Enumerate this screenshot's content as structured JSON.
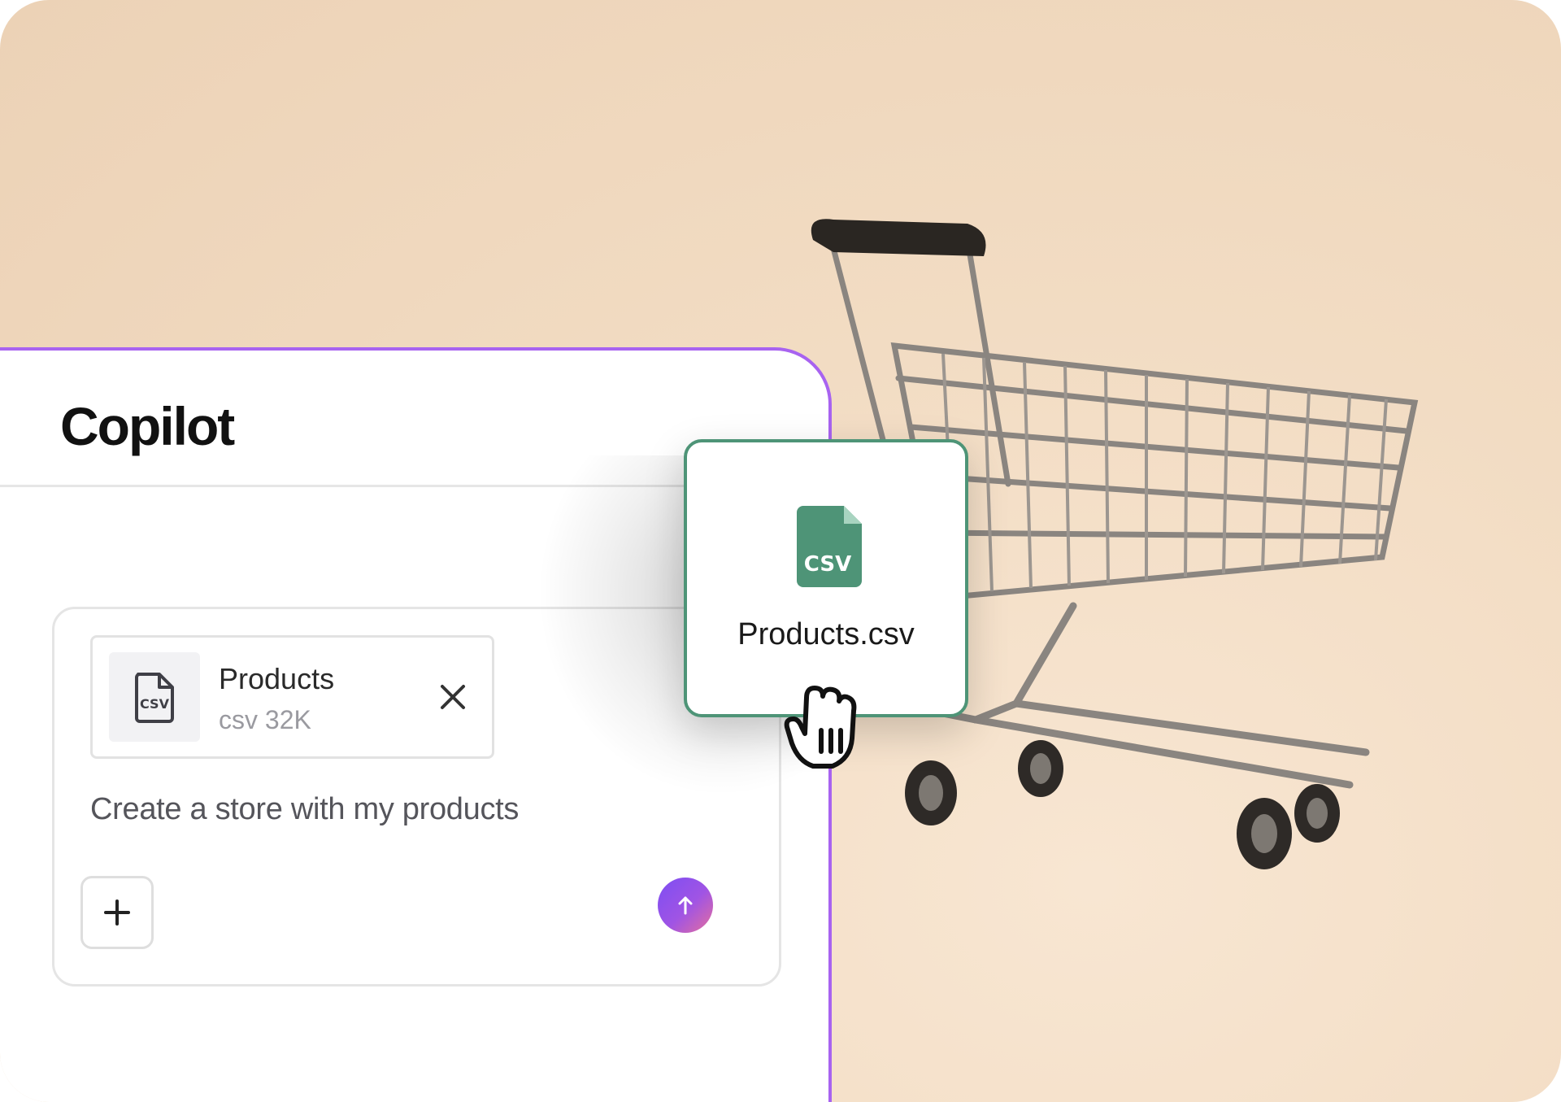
{
  "panel": {
    "title": "Copilot"
  },
  "composer": {
    "attachment": {
      "name": "Products",
      "meta": "csv 32K",
      "icon": "csv-file-icon",
      "badge": "CSV"
    },
    "prompt": "Create a store with my products",
    "add_icon": "plus-icon",
    "send_icon": "arrow-up-icon"
  },
  "drag_item": {
    "filename": "Products.csv",
    "badge": "CSV",
    "icon": "csv-file-icon",
    "cursor": "grabbing-hand-cursor"
  },
  "colors": {
    "accent_border": "#a863f0",
    "file_green": "#4e9477",
    "send_gradient_start": "#7d4ef3",
    "send_gradient_end": "#e56f9c",
    "background": "#f2dcc3"
  }
}
